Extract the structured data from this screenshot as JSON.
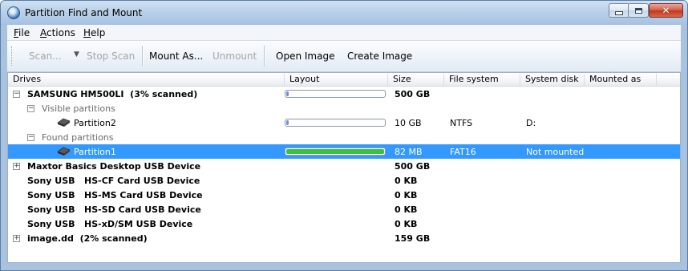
{
  "window": {
    "title": "Partition Find and Mount"
  },
  "menu": [
    "File",
    "Actions",
    "Help"
  ],
  "toolbar": {
    "scan": "Scan...",
    "dropdown_arrow": "▼",
    "stop_scan": "Stop Scan",
    "mount_as": "Mount As...",
    "unmount": "Unmount",
    "open_image": "Open Image",
    "create_image": "Create Image"
  },
  "columns": [
    "Drives",
    "Layout",
    "Size",
    "File system",
    "System disk",
    "Mounted as"
  ],
  "rows": [
    {
      "kind": "drive",
      "expander": "−",
      "name": "SAMSUNG HM500LI  (3% scanned)",
      "layout_fraction": 0.01,
      "size": "500 GB",
      "fs": "",
      "sysdisk": ""
    },
    {
      "kind": "group",
      "expander": "−",
      "name": "Visible partitions",
      "size": "",
      "fs": "",
      "sysdisk": ""
    },
    {
      "kind": "partition",
      "name": "Partition2",
      "layout_fraction": 0.02,
      "size": "10 GB",
      "fs": "NTFS",
      "sysdisk": "D:"
    },
    {
      "kind": "group",
      "expander": "−",
      "name": "Found partitions",
      "size": "",
      "fs": "",
      "sysdisk": ""
    },
    {
      "kind": "partition",
      "selected": true,
      "name": "Partition1",
      "layout_fraction": 1.0,
      "size": "82 MB",
      "fs": "FAT16",
      "sysdisk": "Not mounted"
    },
    {
      "kind": "drive",
      "expander": "+",
      "name": "Maxtor Basics Desktop USB Device",
      "size": "500 GB",
      "fs": "",
      "sysdisk": ""
    },
    {
      "kind": "drive",
      "name": "Sony USB   HS-CF Card USB Device",
      "size": "0 KB",
      "fs": "",
      "sysdisk": ""
    },
    {
      "kind": "drive",
      "name": "Sony USB   HS-MS Card USB Device",
      "size": "0 KB",
      "fs": "",
      "sysdisk": ""
    },
    {
      "kind": "drive",
      "name": "Sony USB   HS-SD Card USB Device",
      "size": "0 KB",
      "fs": "",
      "sysdisk": ""
    },
    {
      "kind": "drive",
      "name": "Sony USB   HS-xD/SM USB Device",
      "size": "0 KB",
      "fs": "",
      "sysdisk": ""
    },
    {
      "kind": "drive",
      "expander": "+",
      "name": "image.dd  (2% scanned)",
      "size": "159 GB",
      "fs": "",
      "sysdisk": ""
    }
  ],
  "colors": {
    "selection": "#3399ff",
    "layout_fill_blue": "#6f8fd6",
    "layout_fill_green": "#3fbf3f"
  }
}
